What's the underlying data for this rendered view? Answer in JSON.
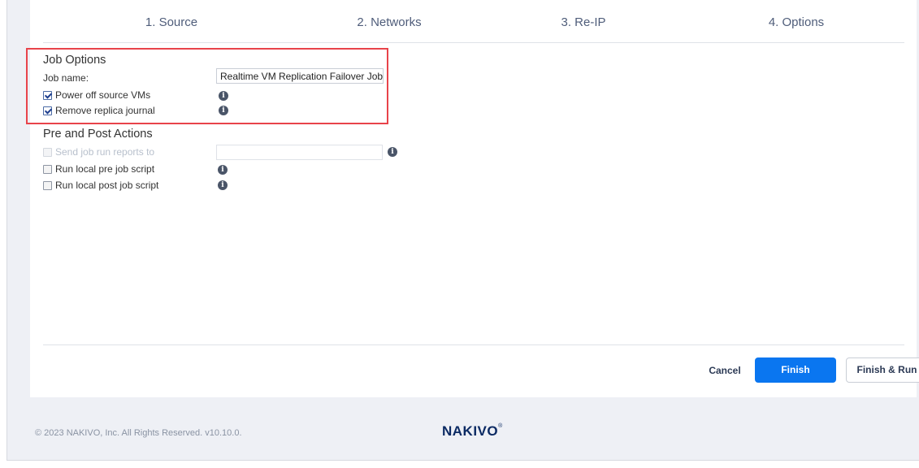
{
  "wizard": {
    "steps": [
      {
        "label": "1. Source"
      },
      {
        "label": "2. Networks"
      },
      {
        "label": "3. Re-IP"
      },
      {
        "label": "4. Options"
      }
    ]
  },
  "job_options": {
    "title": "Job Options",
    "job_name_label": "Job name:",
    "job_name_value": "Realtime VM Replication Failover Job",
    "power_off": {
      "label": "Power off source VMs",
      "checked": true
    },
    "remove_journal": {
      "label": "Remove replica journal",
      "checked": true
    }
  },
  "pre_post": {
    "title": "Pre and Post Actions",
    "send_reports": {
      "label": "Send job run reports to",
      "checked": false,
      "disabled": true,
      "value": ""
    },
    "pre_script": {
      "label": "Run local pre job script",
      "checked": false
    },
    "post_script": {
      "label": "Run local post job script",
      "checked": false
    }
  },
  "actions": {
    "cancel": "Cancel",
    "finish": "Finish",
    "finish_run": "Finish & Run"
  },
  "footer": {
    "copyright": "© 2023 NAKIVO, Inc. All Rights Reserved. v10.10.0.",
    "logo": "NAKIVO",
    "logo_mark": "®"
  },
  "colors": {
    "accent": "#0a76f0",
    "highlight": "#e8434a",
    "background": "#eef0f5"
  },
  "icons": [
    "info-icon",
    "checkbox-checked",
    "checkbox-unchecked"
  ]
}
